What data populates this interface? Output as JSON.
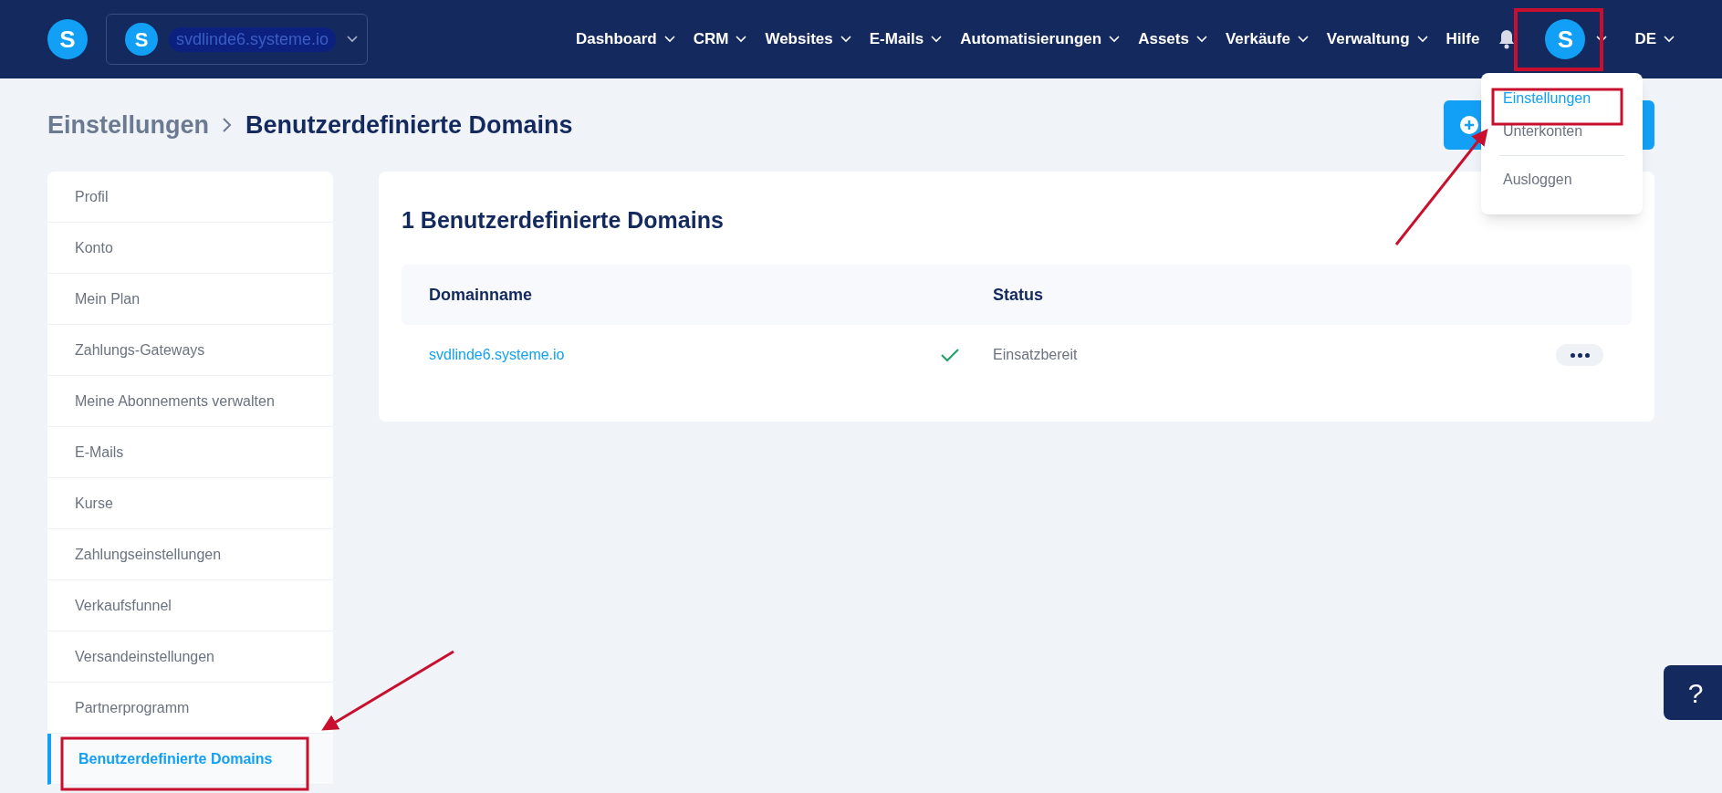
{
  "header": {
    "logo_letter": "S",
    "workspace_logo_letter": "S",
    "workspace": "svdlinde6.systeme.io",
    "nav": [
      {
        "label": "Dashboard",
        "dropdown": true
      },
      {
        "label": "CRM",
        "dropdown": true
      },
      {
        "label": "Websites",
        "dropdown": true
      },
      {
        "label": "E-Mails",
        "dropdown": true
      },
      {
        "label": "Automatisierungen",
        "dropdown": true
      },
      {
        "label": "Assets",
        "dropdown": true
      },
      {
        "label": "Verkäufe",
        "dropdown": true
      },
      {
        "label": "Verwaltung",
        "dropdown": true
      },
      {
        "label": "Hilfe",
        "dropdown": false
      }
    ],
    "avatar_letter": "S",
    "language": "DE"
  },
  "user_menu": [
    {
      "label": "Einstellungen",
      "selected": true
    },
    {
      "label": "Unterkonten",
      "selected": false
    },
    {
      "label": "Ausloggen",
      "selected": false
    }
  ],
  "breadcrumb": [
    "Einstellungen",
    "Benutzerdefinierte Domains"
  ],
  "sidebar": {
    "items": [
      {
        "label": "Profil",
        "selected": false
      },
      {
        "label": "Konto",
        "selected": false
      },
      {
        "label": "Mein Plan",
        "selected": false
      },
      {
        "label": "Zahlungs-Gateways",
        "selected": false
      },
      {
        "label": "Meine Abonnements verwalten",
        "selected": false
      },
      {
        "label": "E-Mails",
        "selected": false
      },
      {
        "label": "Kurse",
        "selected": false
      },
      {
        "label": "Zahlungseinstellungen",
        "selected": false
      },
      {
        "label": "Verkaufsfunnel",
        "selected": false
      },
      {
        "label": "Versandeinstellungen",
        "selected": false
      },
      {
        "label": "Partnerprogramm",
        "selected": false
      },
      {
        "label": "Benutzerdefinierte Domains",
        "selected": true
      }
    ]
  },
  "domains": {
    "title": "1 Benutzerdefinierte Domains",
    "columns": [
      "Domainname",
      "Status"
    ],
    "rows": [
      {
        "domain": "svdlinde6.systeme.io",
        "ready": true,
        "status": "Einsatzbereit"
      }
    ]
  },
  "help_button": "?"
}
